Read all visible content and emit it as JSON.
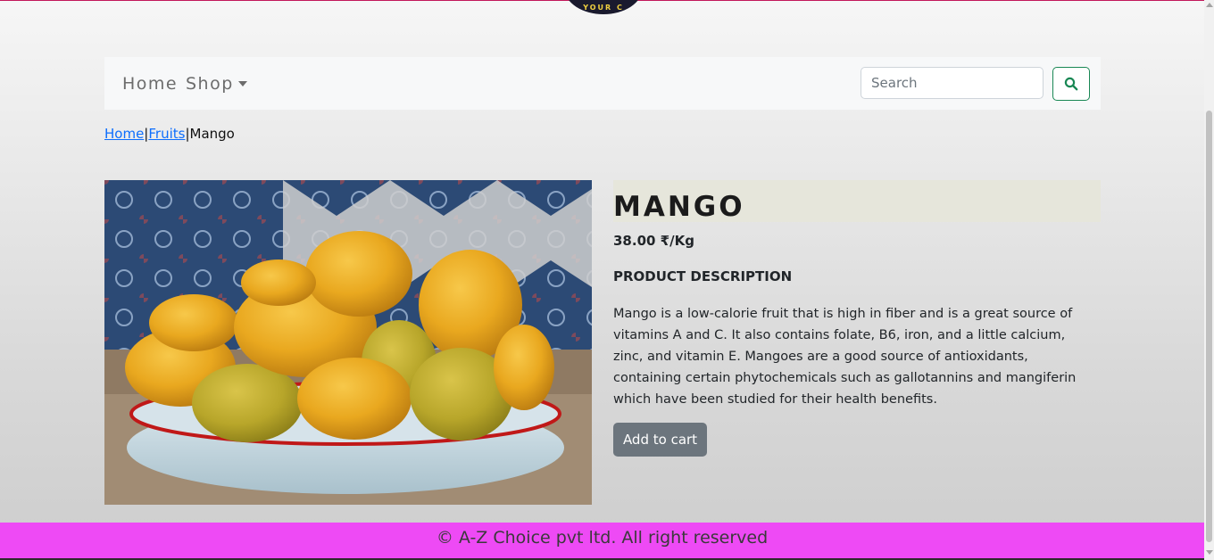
{
  "navbar": {
    "home_label": "Home",
    "shop_label": "Shop",
    "search_placeholder": "Search"
  },
  "breadcrumb": {
    "home": "Home",
    "category": "Fruits",
    "current": "Mango",
    "separator": "|"
  },
  "product": {
    "title": "MANGO",
    "price": "38.00 ₹/Kg",
    "description_heading": "PRODUCT DESCRIPTION",
    "description": "Mango is a low-calorie fruit that is high in fiber and is a great source of vitamins A and C. It also contains folate, B6, iron, and a little calcium, zinc, and vitamin E. Mangoes are a good source of antioxidants, containing certain phytochemicals such as gallotannins and mangiferin which have been studied for their health benefits.",
    "add_to_cart_label": "Add to cart"
  },
  "footer": {
    "text": "© A-Z Choice pvt ltd. All right reserved"
  },
  "logo": {
    "text": "YOUR C"
  },
  "icons": {
    "search": "search-icon",
    "shop_dropdown": "caret-down-icon"
  },
  "colors": {
    "footer_bg": "#ee4af5",
    "link": "#0d6efd",
    "search_button_border": "#198754",
    "cart_button_bg": "#6c757d"
  }
}
